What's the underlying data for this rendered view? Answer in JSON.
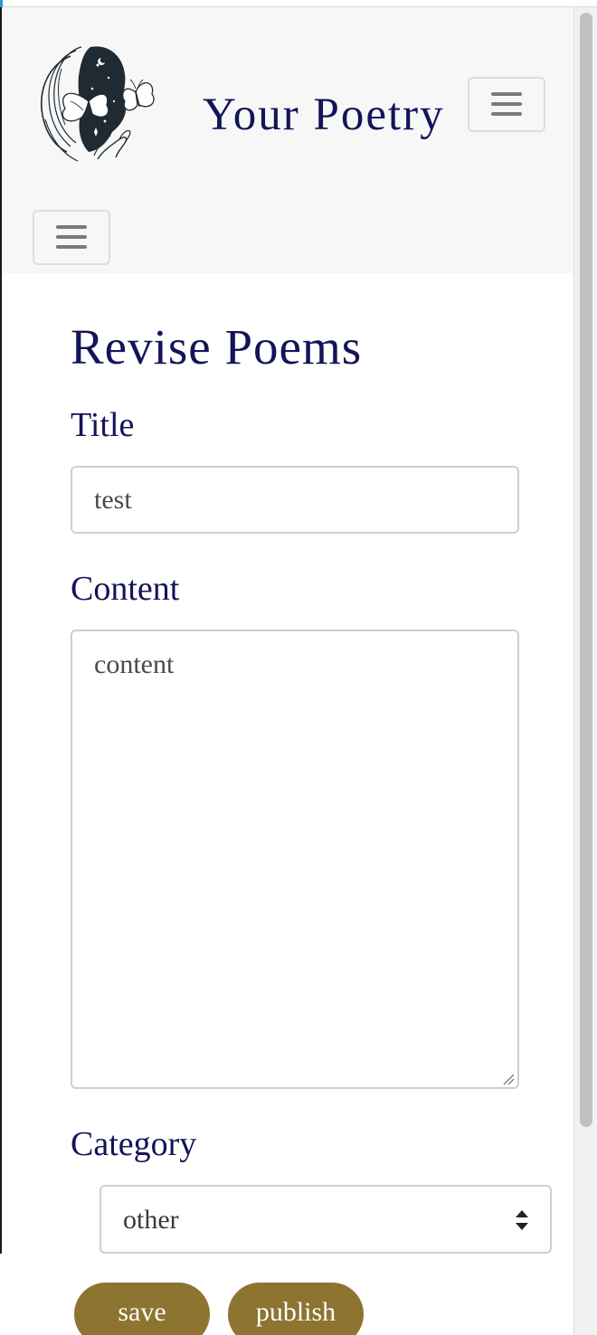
{
  "navbar": {
    "brand": "Your Poetry",
    "logo_icon": "woman-butterfly-logo",
    "toggler_icon": "hamburger-menu-icon"
  },
  "form": {
    "heading": "Revise Poems",
    "title_label": "Title",
    "title_value": "test",
    "content_label": "Content",
    "content_value": "content",
    "category_label": "Category",
    "category_value": "other",
    "save_label": "save",
    "publish_label": "publish"
  },
  "colors": {
    "heading": "#14145a",
    "button": "#8d7430",
    "navbar_bg": "#f7f7f7"
  }
}
